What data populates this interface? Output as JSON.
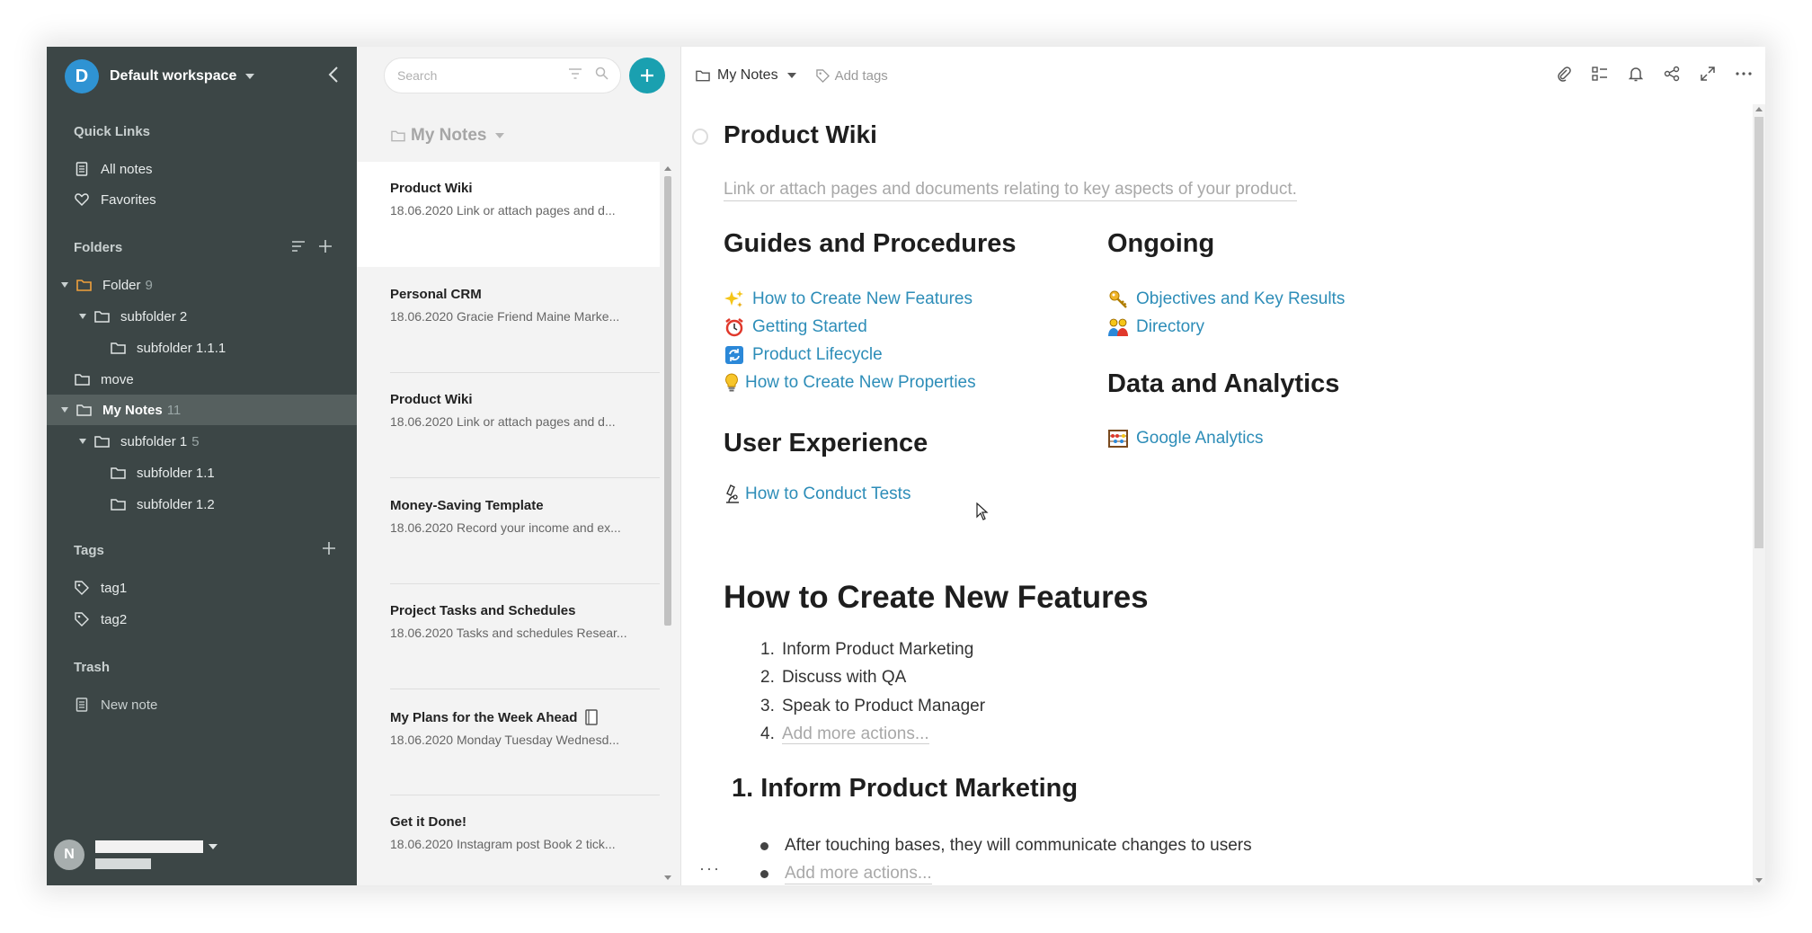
{
  "workspace": {
    "avatar": "D",
    "name": "Default workspace"
  },
  "sidebar": {
    "quick_links_title": "Quick Links",
    "quick_links": [
      {
        "label": "All notes"
      },
      {
        "label": "Favorites"
      }
    ],
    "folders_title": "Folders",
    "folders": [
      {
        "label": "Folder",
        "count": "9"
      },
      {
        "label": "subfolder 2",
        "count": ""
      },
      {
        "label": "subfolder 1.1.1",
        "count": ""
      },
      {
        "label": "move",
        "count": ""
      },
      {
        "label": "My Notes",
        "count": "11"
      },
      {
        "label": "subfolder 1",
        "count": "5"
      },
      {
        "label": "subfolder 1.1",
        "count": ""
      },
      {
        "label": "subfolder 1.2",
        "count": ""
      }
    ],
    "tags_title": "Tags",
    "tags": [
      {
        "label": "tag1"
      },
      {
        "label": "tag2"
      }
    ],
    "trash_title": "Trash",
    "trash_items": [
      {
        "label": "New note"
      }
    ],
    "user_avatar": "N"
  },
  "notelist": {
    "search_placeholder": "Search",
    "folder": "My Notes",
    "notes": [
      {
        "title": "Product Wiki",
        "preview": "18.06.2020 Link or attach pages and d..."
      },
      {
        "title": "Personal CRM",
        "preview": "18.06.2020 Gracie Friend Maine Marke..."
      },
      {
        "title": "Product Wiki",
        "preview": "18.06.2020 Link or attach pages and d..."
      },
      {
        "title": "Money-Saving Template",
        "preview": "18.06.2020 Record your income and ex..."
      },
      {
        "title": "Project Tasks and Schedules",
        "preview": "18.06.2020 Tasks and schedules Resear..."
      },
      {
        "title": "My Plans for the Week Ahead",
        "preview": "18.06.2020 Monday Tuesday Wednesd..."
      },
      {
        "title": "Get it Done!",
        "preview": "18.06.2020 Instagram post Book 2 tick..."
      }
    ]
  },
  "editor": {
    "breadcrumb": "My Notes",
    "add_tags": "Add tags",
    "title": "Product Wiki",
    "subtitle": "Link or attach pages and documents relating to key aspects of your product.",
    "guides_title": "Guides and Procedures",
    "guides": [
      {
        "label": "How to Create New Features",
        "icon": "sparkles-icon"
      },
      {
        "label": "Getting Started",
        "icon": "alarm-clock-icon"
      },
      {
        "label": "Product Lifecycle",
        "icon": "cycle-icon"
      },
      {
        "label": "How to Create New Properties",
        "icon": "lightbulb-icon"
      }
    ],
    "ux_title": "User Experience",
    "ux_links": [
      {
        "label": "How to Conduct Tests",
        "icon": "microscope-icon"
      }
    ],
    "ongoing_title": "Ongoing",
    "ongoing": [
      {
        "label": "Objectives and Key Results",
        "icon": "key-icon"
      },
      {
        "label": "Directory",
        "icon": "people-icon"
      }
    ],
    "data_title": "Data and Analytics",
    "data_links": [
      {
        "label": "Google Analytics",
        "icon": "abacus-icon"
      }
    ],
    "section_title": "How to Create New Features",
    "steps": [
      {
        "num": "1.",
        "label": "Inform Product Marketing"
      },
      {
        "num": "2.",
        "label": "Discuss with QA"
      },
      {
        "num": "3.",
        "label": "Speak to Product Manager"
      },
      {
        "num": "4.",
        "label": "Add more actions..."
      }
    ],
    "sub_title": "1. Inform Product Marketing",
    "bullets": [
      {
        "label": "After touching bases, they will communicate changes to users"
      },
      {
        "label": "Add more actions..."
      }
    ],
    "more": "···"
  }
}
